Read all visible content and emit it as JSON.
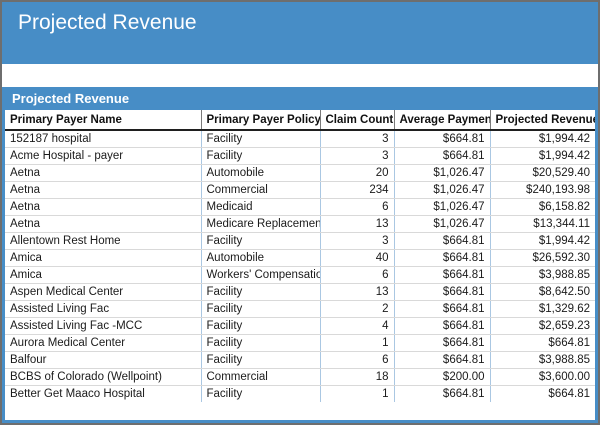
{
  "page": {
    "title": "Projected Revenue"
  },
  "report": {
    "title": "Projected Revenue",
    "table": {
      "columns": [
        {
          "label": "Primary Payer Name",
          "align": "left"
        },
        {
          "label": "Primary Payer Policy",
          "align": "left"
        },
        {
          "label": "Claim Count",
          "align": "right"
        },
        {
          "label": "Average Payment",
          "align": "right"
        },
        {
          "label": "Projected Revenue",
          "align": "right"
        }
      ],
      "rows": [
        [
          "152187 hospital",
          "Facility",
          "3",
          "$664.81",
          "$1,994.42"
        ],
        [
          "Acme Hospital - payer",
          "Facility",
          "3",
          "$664.81",
          "$1,994.42"
        ],
        [
          "Aetna",
          "Automobile",
          "20",
          "$1,026.47",
          "$20,529.40"
        ],
        [
          "Aetna",
          "Commercial",
          "234",
          "$1,026.47",
          "$240,193.98"
        ],
        [
          "Aetna",
          "Medicaid",
          "6",
          "$1,026.47",
          "$6,158.82"
        ],
        [
          "Aetna",
          "Medicare Replacement",
          "13",
          "$1,026.47",
          "$13,344.11"
        ],
        [
          "Allentown Rest Home",
          "Facility",
          "3",
          "$664.81",
          "$1,994.42"
        ],
        [
          "Amica",
          "Automobile",
          "40",
          "$664.81",
          "$26,592.30"
        ],
        [
          "Amica",
          "Workers' Compensation",
          "6",
          "$664.81",
          "$3,988.85"
        ],
        [
          "Aspen Medical Center",
          "Facility",
          "13",
          "$664.81",
          "$8,642.50"
        ],
        [
          "Assisted Living Fac",
          "Facility",
          "2",
          "$664.81",
          "$1,329.62"
        ],
        [
          "Assisted Living Fac -MCC",
          "Facility",
          "4",
          "$664.81",
          "$2,659.23"
        ],
        [
          "Aurora Medical Center",
          "Facility",
          "1",
          "$664.81",
          "$664.81"
        ],
        [
          "Balfour",
          "Facility",
          "6",
          "$664.81",
          "$3,988.85"
        ],
        [
          "BCBS of Colorado (Wellpoint)",
          "Commercial",
          "18",
          "$200.00",
          "$3,600.00"
        ],
        [
          "Better Get Maaco Hospital",
          "Facility",
          "1",
          "$664.81",
          "$664.81"
        ]
      ]
    }
  },
  "colors": {
    "accent_blue": "#478dc6",
    "window_border": "#6e6e6e",
    "grid_vertical": "#aac7e2",
    "grid_horizontal": "#d9d9d9",
    "header_underline": "#1f1f1f"
  }
}
